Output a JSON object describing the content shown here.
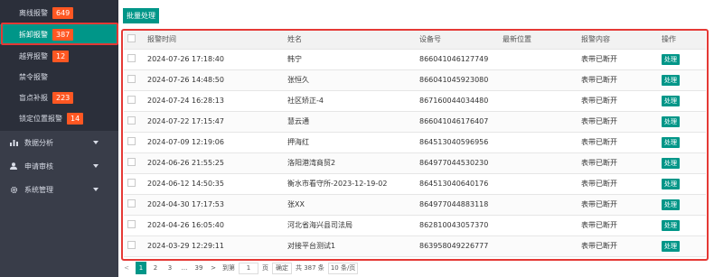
{
  "sidebar": {
    "sub_items": [
      {
        "label": "离线报警",
        "badge": "649",
        "active": false
      },
      {
        "label": "拆卸报警",
        "badge": "387",
        "active": true
      },
      {
        "label": "越界报警",
        "badge": "12",
        "active": false
      },
      {
        "label": "禁令报警",
        "badge": "",
        "active": false
      },
      {
        "label": "盲点补报",
        "badge": "223",
        "active": false
      },
      {
        "label": "锁定位置报警",
        "badge": "14",
        "active": false
      }
    ],
    "groups": [
      {
        "label": "数据分析",
        "icon": "bar-chart-icon"
      },
      {
        "label": "申请审核",
        "icon": "user-icon"
      },
      {
        "label": "系统管理",
        "icon": "gear-icon"
      }
    ]
  },
  "toolbar": {
    "batch_label": "批量处理"
  },
  "table": {
    "columns": [
      "报警时间",
      "姓名",
      "设备号",
      "最新位置",
      "报警内容",
      "操作"
    ],
    "rows": [
      {
        "time": "2024-07-26 17:18:40",
        "name": "韩宁",
        "device": "866041046127749",
        "location": "",
        "content": "表带已断开",
        "action": "处理"
      },
      {
        "time": "2024-07-26 14:48:50",
        "name": "张恒久",
        "device": "866041045923080",
        "location": "",
        "content": "表带已断开",
        "action": "处理"
      },
      {
        "time": "2024-07-24 16:28:13",
        "name": "社区矫正-4",
        "device": "867160044034480",
        "location": "",
        "content": "表带已断开",
        "action": "处理"
      },
      {
        "time": "2024-07-22 17:15:47",
        "name": "慧云通",
        "device": "866041046176407",
        "location": "",
        "content": "表带已断开",
        "action": "处理"
      },
      {
        "time": "2024-07-09 12:19:06",
        "name": "押海红",
        "device": "864513040596956",
        "location": "",
        "content": "表带已断开",
        "action": "处理"
      },
      {
        "time": "2024-06-26 21:55:25",
        "name": "洛阳港湾商贸2",
        "device": "864977044530230",
        "location": "",
        "content": "表带已断开",
        "action": "处理"
      },
      {
        "time": "2024-06-12 14:50:35",
        "name": "衡水市看守所-2023-12-19-02",
        "device": "864513040640176",
        "location": "",
        "content": "表带已断开",
        "action": "处理"
      },
      {
        "time": "2024-04-30 17:17:53",
        "name": "张XX",
        "device": "864977044883118",
        "location": "",
        "content": "表带已断开",
        "action": "处理"
      },
      {
        "time": "2024-04-26 16:05:40",
        "name": "河北省海兴县司法局",
        "device": "862810043057370",
        "location": "",
        "content": "表带已断开",
        "action": "处理"
      },
      {
        "time": "2024-03-29 12:29:11",
        "name": "对接平台测试1",
        "device": "863958049226777",
        "location": "",
        "content": "表带已断开",
        "action": "处理"
      }
    ]
  },
  "pager": {
    "prev": "<",
    "pages": [
      "1",
      "2",
      "3",
      "...",
      "39"
    ],
    "next": ">",
    "goto_label": "到第",
    "goto_value": "1",
    "page_unit": "页",
    "confirm": "确定",
    "total": "共 387 条",
    "page_size": "10 条/页"
  },
  "colors": {
    "accent": "#009688",
    "badge": "#ff5722",
    "sidebar": "#393d49",
    "highlight": "#e53935"
  }
}
